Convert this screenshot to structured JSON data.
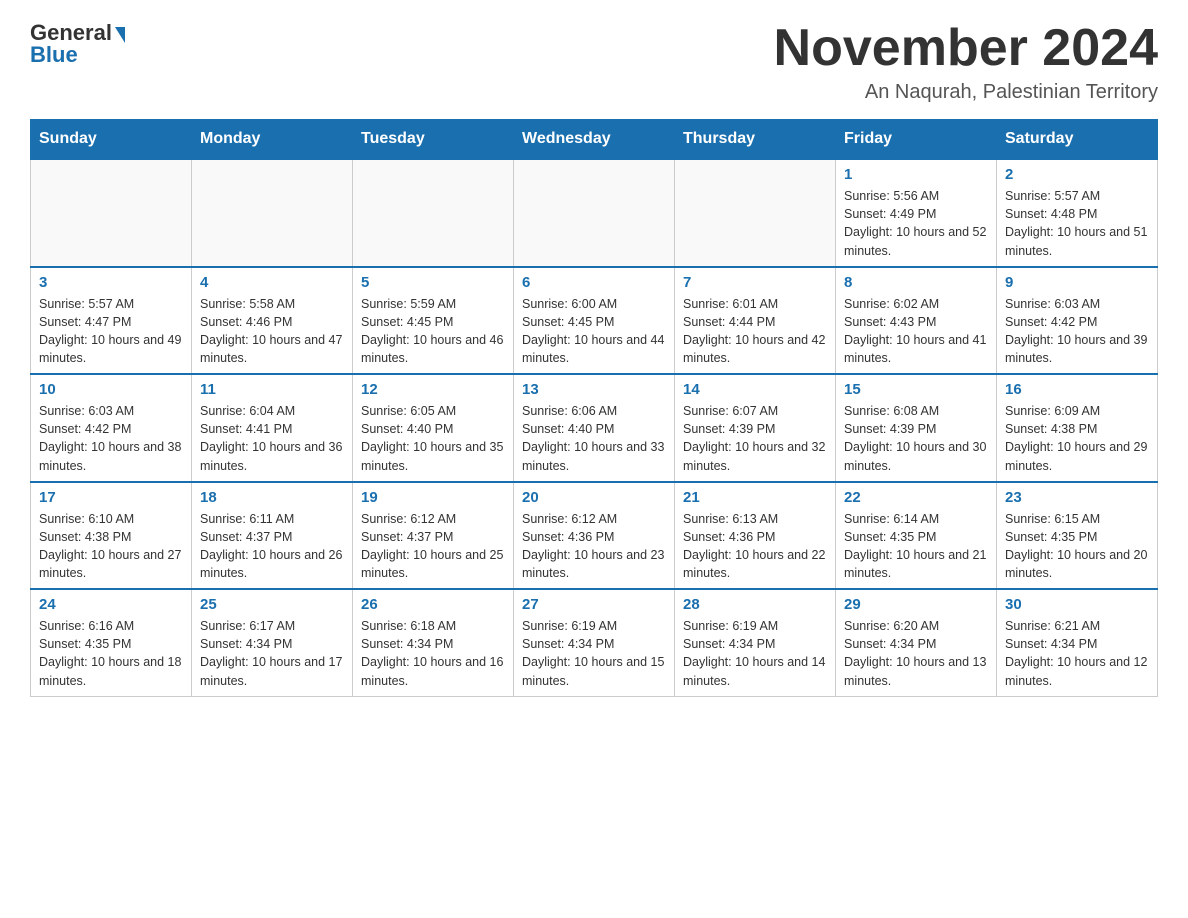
{
  "logo": {
    "general": "General",
    "blue": "Blue"
  },
  "title": "November 2024",
  "location": "An Naqurah, Palestinian Territory",
  "days_of_week": [
    "Sunday",
    "Monday",
    "Tuesday",
    "Wednesday",
    "Thursday",
    "Friday",
    "Saturday"
  ],
  "weeks": [
    [
      {
        "day": "",
        "info": ""
      },
      {
        "day": "",
        "info": ""
      },
      {
        "day": "",
        "info": ""
      },
      {
        "day": "",
        "info": ""
      },
      {
        "day": "",
        "info": ""
      },
      {
        "day": "1",
        "info": "Sunrise: 5:56 AM\nSunset: 4:49 PM\nDaylight: 10 hours and 52 minutes."
      },
      {
        "day": "2",
        "info": "Sunrise: 5:57 AM\nSunset: 4:48 PM\nDaylight: 10 hours and 51 minutes."
      }
    ],
    [
      {
        "day": "3",
        "info": "Sunrise: 5:57 AM\nSunset: 4:47 PM\nDaylight: 10 hours and 49 minutes."
      },
      {
        "day": "4",
        "info": "Sunrise: 5:58 AM\nSunset: 4:46 PM\nDaylight: 10 hours and 47 minutes."
      },
      {
        "day": "5",
        "info": "Sunrise: 5:59 AM\nSunset: 4:45 PM\nDaylight: 10 hours and 46 minutes."
      },
      {
        "day": "6",
        "info": "Sunrise: 6:00 AM\nSunset: 4:45 PM\nDaylight: 10 hours and 44 minutes."
      },
      {
        "day": "7",
        "info": "Sunrise: 6:01 AM\nSunset: 4:44 PM\nDaylight: 10 hours and 42 minutes."
      },
      {
        "day": "8",
        "info": "Sunrise: 6:02 AM\nSunset: 4:43 PM\nDaylight: 10 hours and 41 minutes."
      },
      {
        "day": "9",
        "info": "Sunrise: 6:03 AM\nSunset: 4:42 PM\nDaylight: 10 hours and 39 minutes."
      }
    ],
    [
      {
        "day": "10",
        "info": "Sunrise: 6:03 AM\nSunset: 4:42 PM\nDaylight: 10 hours and 38 minutes."
      },
      {
        "day": "11",
        "info": "Sunrise: 6:04 AM\nSunset: 4:41 PM\nDaylight: 10 hours and 36 minutes."
      },
      {
        "day": "12",
        "info": "Sunrise: 6:05 AM\nSunset: 4:40 PM\nDaylight: 10 hours and 35 minutes."
      },
      {
        "day": "13",
        "info": "Sunrise: 6:06 AM\nSunset: 4:40 PM\nDaylight: 10 hours and 33 minutes."
      },
      {
        "day": "14",
        "info": "Sunrise: 6:07 AM\nSunset: 4:39 PM\nDaylight: 10 hours and 32 minutes."
      },
      {
        "day": "15",
        "info": "Sunrise: 6:08 AM\nSunset: 4:39 PM\nDaylight: 10 hours and 30 minutes."
      },
      {
        "day": "16",
        "info": "Sunrise: 6:09 AM\nSunset: 4:38 PM\nDaylight: 10 hours and 29 minutes."
      }
    ],
    [
      {
        "day": "17",
        "info": "Sunrise: 6:10 AM\nSunset: 4:38 PM\nDaylight: 10 hours and 27 minutes."
      },
      {
        "day": "18",
        "info": "Sunrise: 6:11 AM\nSunset: 4:37 PM\nDaylight: 10 hours and 26 minutes."
      },
      {
        "day": "19",
        "info": "Sunrise: 6:12 AM\nSunset: 4:37 PM\nDaylight: 10 hours and 25 minutes."
      },
      {
        "day": "20",
        "info": "Sunrise: 6:12 AM\nSunset: 4:36 PM\nDaylight: 10 hours and 23 minutes."
      },
      {
        "day": "21",
        "info": "Sunrise: 6:13 AM\nSunset: 4:36 PM\nDaylight: 10 hours and 22 minutes."
      },
      {
        "day": "22",
        "info": "Sunrise: 6:14 AM\nSunset: 4:35 PM\nDaylight: 10 hours and 21 minutes."
      },
      {
        "day": "23",
        "info": "Sunrise: 6:15 AM\nSunset: 4:35 PM\nDaylight: 10 hours and 20 minutes."
      }
    ],
    [
      {
        "day": "24",
        "info": "Sunrise: 6:16 AM\nSunset: 4:35 PM\nDaylight: 10 hours and 18 minutes."
      },
      {
        "day": "25",
        "info": "Sunrise: 6:17 AM\nSunset: 4:34 PM\nDaylight: 10 hours and 17 minutes."
      },
      {
        "day": "26",
        "info": "Sunrise: 6:18 AM\nSunset: 4:34 PM\nDaylight: 10 hours and 16 minutes."
      },
      {
        "day": "27",
        "info": "Sunrise: 6:19 AM\nSunset: 4:34 PM\nDaylight: 10 hours and 15 minutes."
      },
      {
        "day": "28",
        "info": "Sunrise: 6:19 AM\nSunset: 4:34 PM\nDaylight: 10 hours and 14 minutes."
      },
      {
        "day": "29",
        "info": "Sunrise: 6:20 AM\nSunset: 4:34 PM\nDaylight: 10 hours and 13 minutes."
      },
      {
        "day": "30",
        "info": "Sunrise: 6:21 AM\nSunset: 4:34 PM\nDaylight: 10 hours and 12 minutes."
      }
    ]
  ]
}
